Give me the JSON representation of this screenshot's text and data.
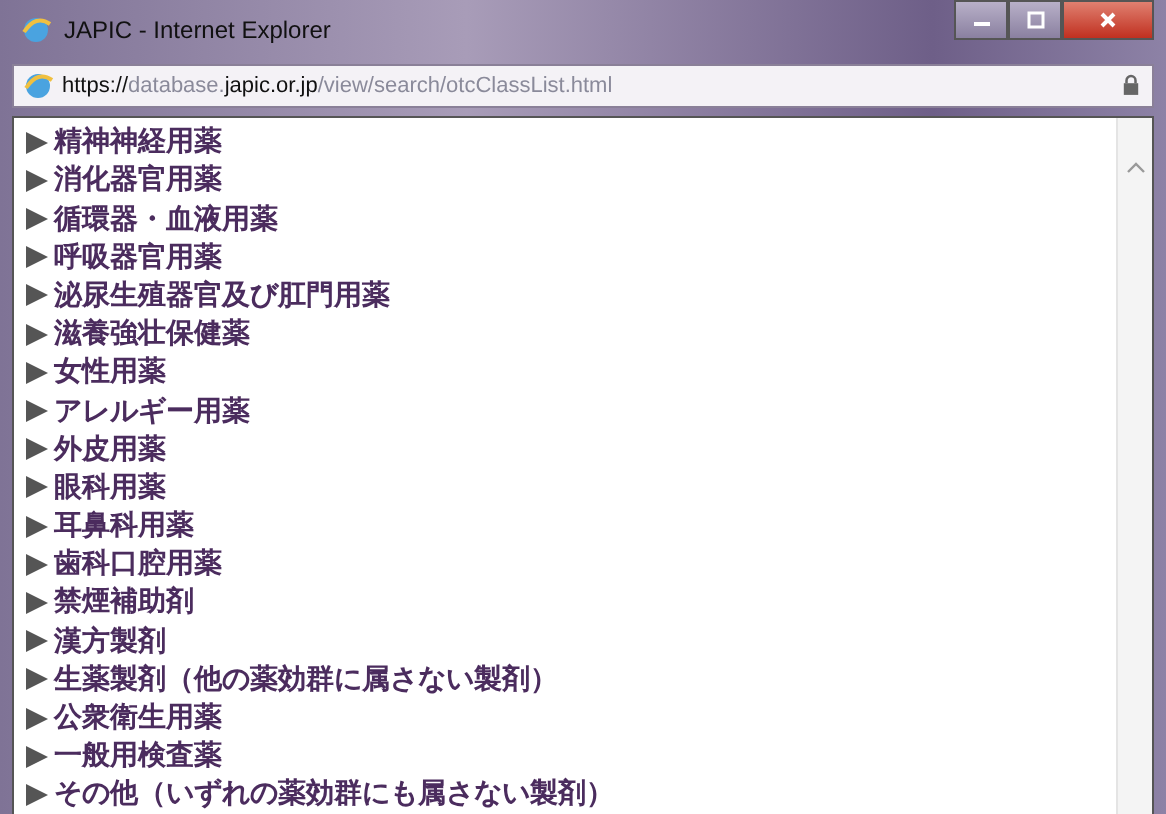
{
  "window": {
    "title": "JAPIC - Internet Explorer"
  },
  "address_bar": {
    "url_parts": [
      {
        "text": "https://",
        "strong": true
      },
      {
        "text": "database.",
        "strong": false
      },
      {
        "text": "japic.or.jp",
        "strong": true
      },
      {
        "text": "/view/search/otcClassList.html",
        "strong": false
      }
    ]
  },
  "categories": [
    {
      "label": "精神神経用薬"
    },
    {
      "label": "消化器官用薬"
    },
    {
      "label": "循環器・血液用薬"
    },
    {
      "label": "呼吸器官用薬"
    },
    {
      "label": "泌尿生殖器官及び肛門用薬"
    },
    {
      "label": "滋養強壮保健薬"
    },
    {
      "label": "女性用薬"
    },
    {
      "label": "アレルギー用薬"
    },
    {
      "label": "外皮用薬"
    },
    {
      "label": "眼科用薬"
    },
    {
      "label": "耳鼻科用薬"
    },
    {
      "label": "歯科口腔用薬"
    },
    {
      "label": "禁煙補助剤"
    },
    {
      "label": "漢方製剤"
    },
    {
      "label": "生薬製剤（他の薬効群に属さない製剤）"
    },
    {
      "label": "公衆衛生用薬"
    },
    {
      "label": "一般用検査薬"
    },
    {
      "label": "その他（いずれの薬効群にも属さない製剤）"
    }
  ]
}
